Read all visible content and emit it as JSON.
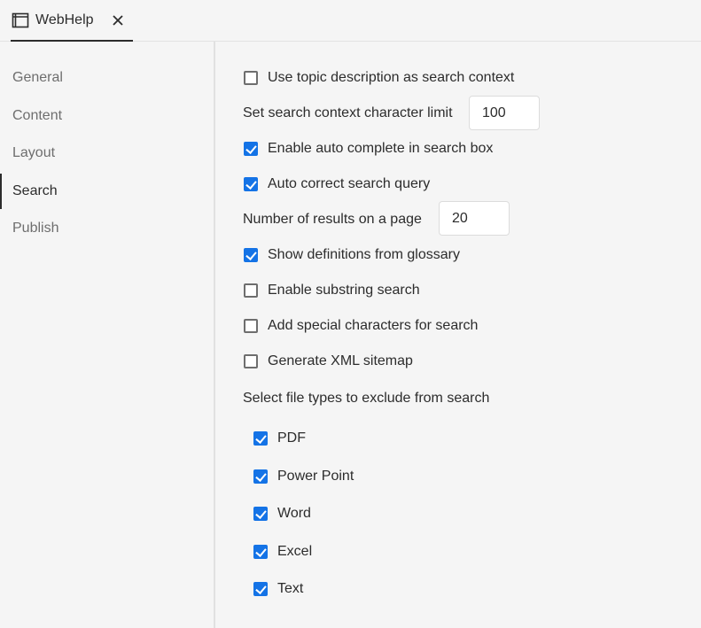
{
  "tab": {
    "label": "WebHelp",
    "close_glyph": "✕",
    "icon": "window-icon"
  },
  "sidebar": {
    "items": [
      {
        "label": "General",
        "selected": false
      },
      {
        "label": "Content",
        "selected": false
      },
      {
        "label": "Layout",
        "selected": false
      },
      {
        "label": "Search",
        "selected": true
      },
      {
        "label": "Publish",
        "selected": false
      }
    ]
  },
  "search": {
    "use_topic_description": {
      "label": "Use topic description as search context",
      "checked": false
    },
    "context_char_limit": {
      "label": "Set search context character limit",
      "value": "100"
    },
    "auto_complete": {
      "label": "Enable auto complete in search box",
      "checked": true
    },
    "auto_correct": {
      "label": "Auto correct search query",
      "checked": true
    },
    "results_per_page": {
      "label": "Number of results on a page",
      "value": "20"
    },
    "show_definitions": {
      "label": "Show definitions from glossary",
      "checked": true
    },
    "substring_search": {
      "label": "Enable substring search",
      "checked": false
    },
    "special_characters": {
      "label": "Add special characters for search",
      "checked": false
    },
    "xml_sitemap": {
      "label": "Generate XML sitemap",
      "checked": false
    },
    "exclude_heading": "Select file types to exclude from search",
    "file_types": [
      {
        "label": "PDF",
        "checked": true
      },
      {
        "label": "Power Point",
        "checked": true
      },
      {
        "label": "Word",
        "checked": true
      },
      {
        "label": "Excel",
        "checked": true
      },
      {
        "label": "Text",
        "checked": true
      }
    ]
  },
  "colors": {
    "accent": "#1473e6",
    "text": "#2c2c2c",
    "muted": "#6e6e6e",
    "background": "#f5f5f5"
  }
}
